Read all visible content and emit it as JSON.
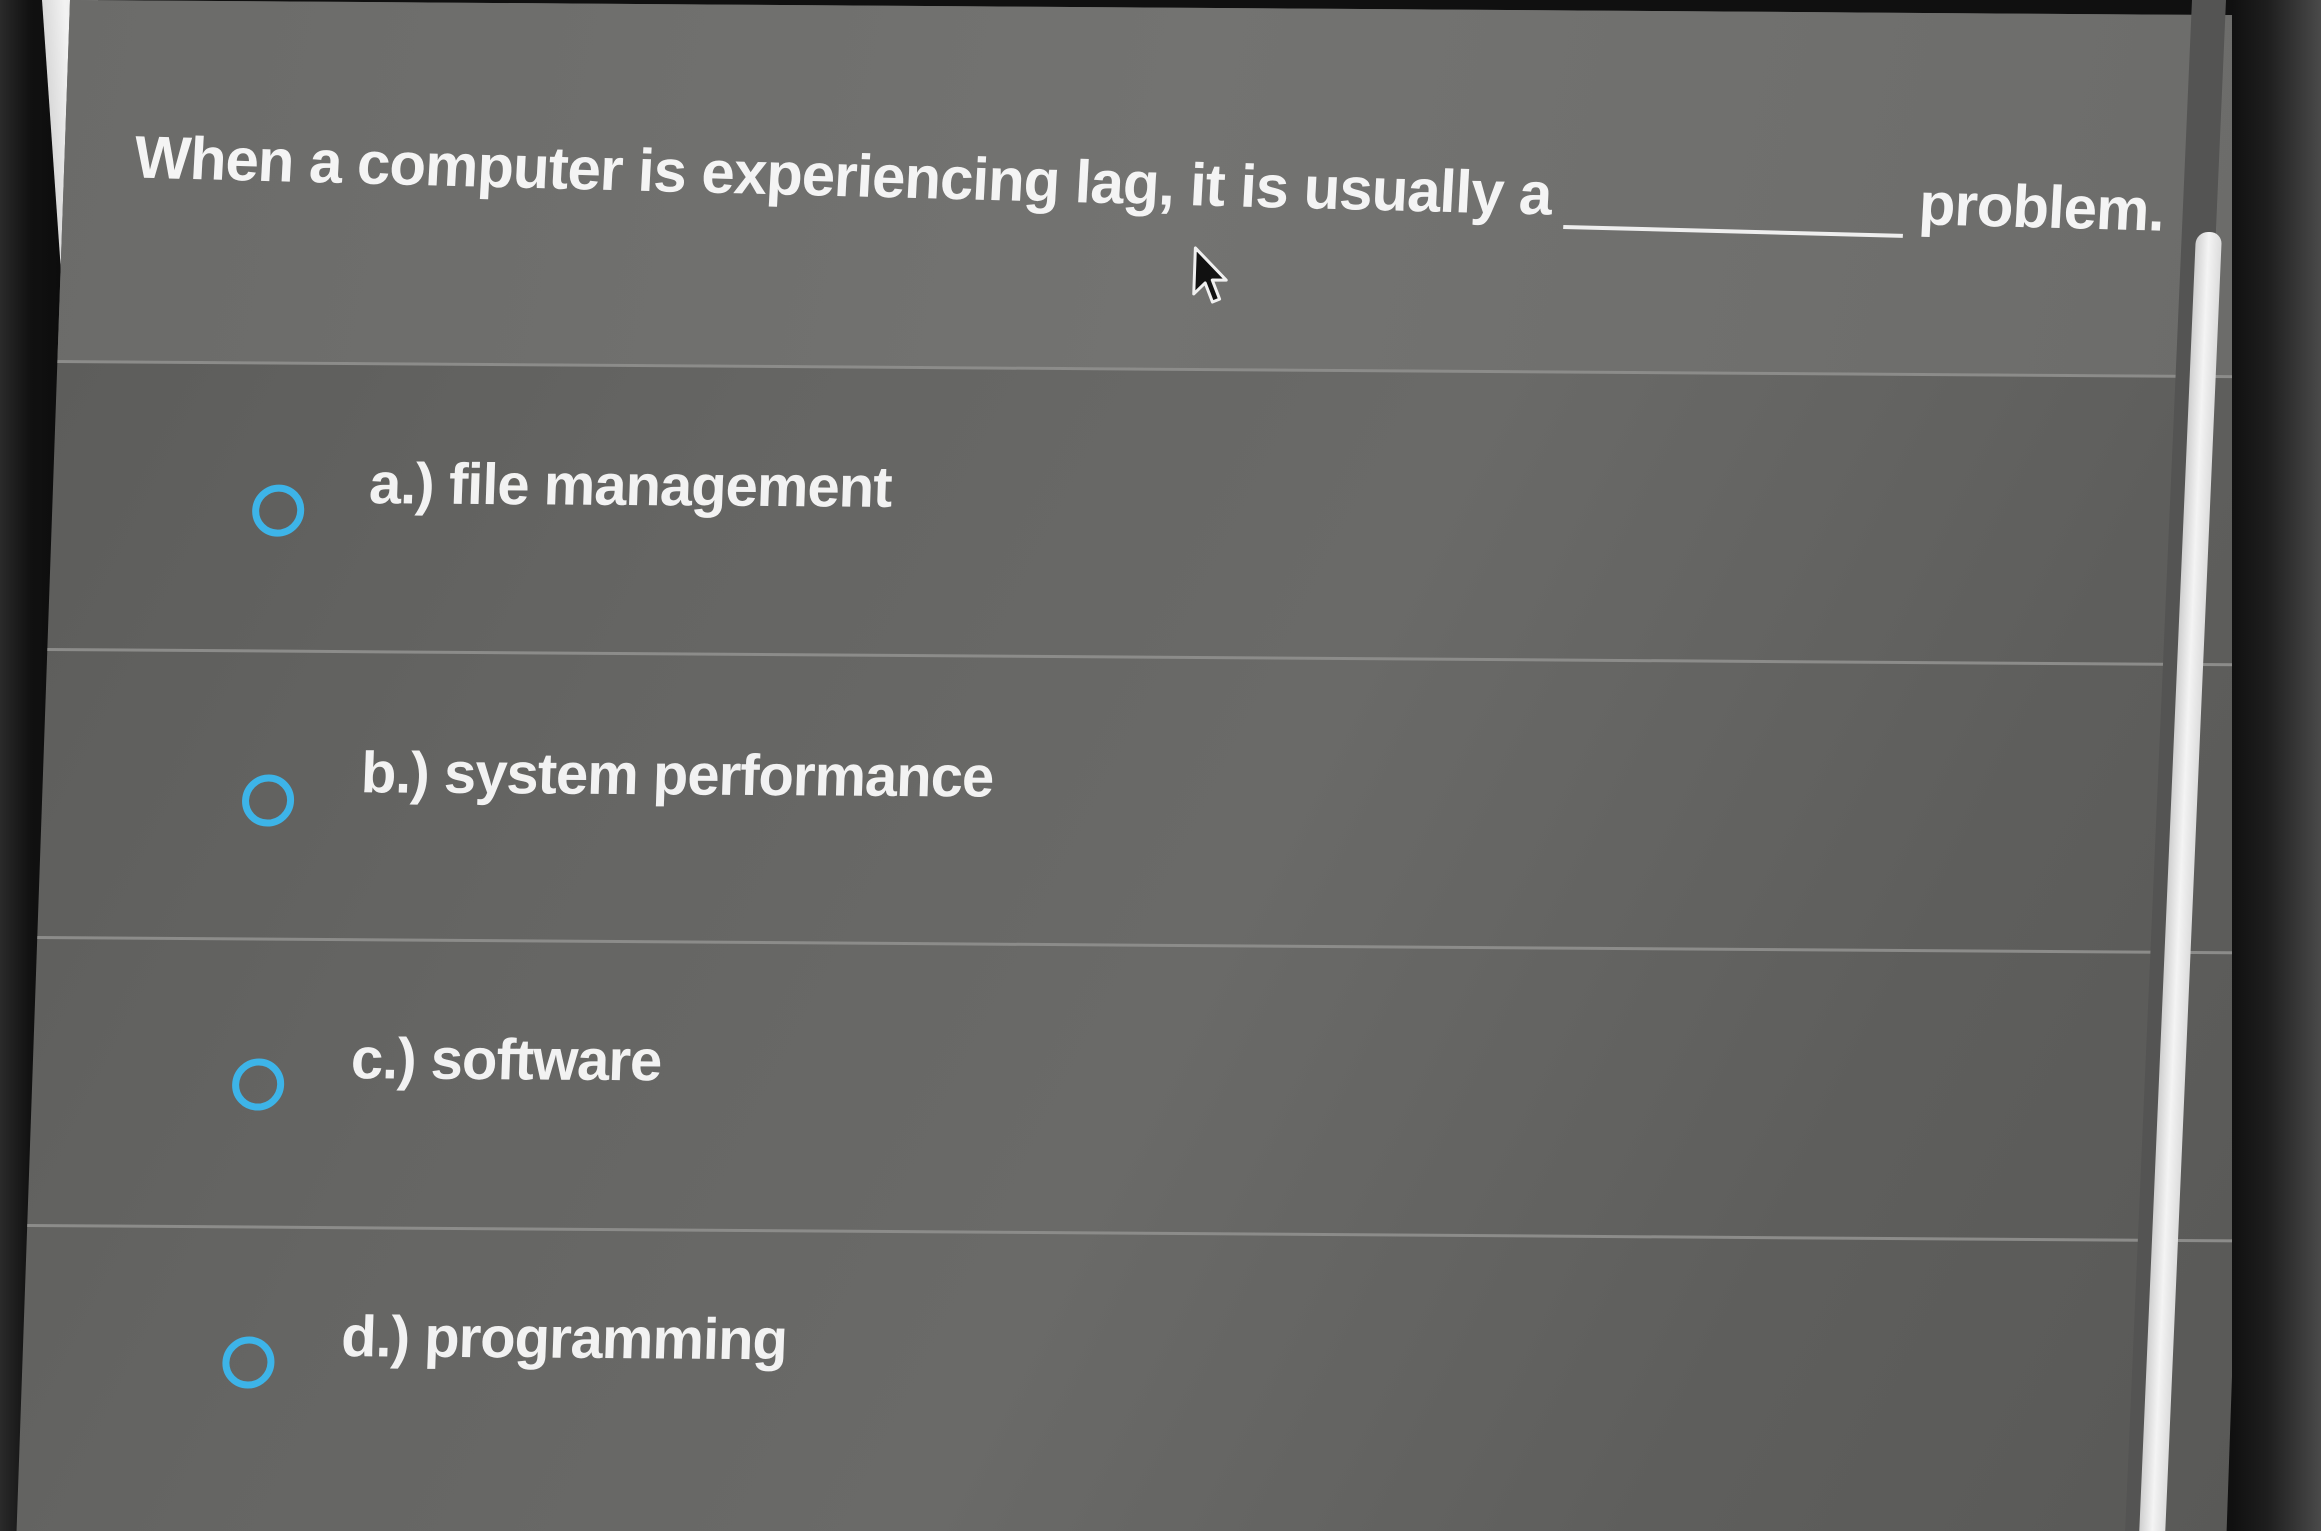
{
  "question": {
    "text_before": "When a computer is experiencing lag, it is usually a",
    "text_after": "problem."
  },
  "options": [
    {
      "letter": "a.)",
      "label": "file management",
      "selected": false
    },
    {
      "letter": "b.)",
      "label": "system performance",
      "selected": false
    },
    {
      "letter": "c.)",
      "label": "software",
      "selected": false
    },
    {
      "letter": "d.)",
      "label": "programming",
      "selected": false
    }
  ],
  "colors": {
    "radio_accent": "#3db4e8",
    "background": "#666664",
    "text": "#f2f2f2"
  },
  "icons": {
    "cursor": "mouse-pointer-icon",
    "radio": "radio-button-icon"
  }
}
